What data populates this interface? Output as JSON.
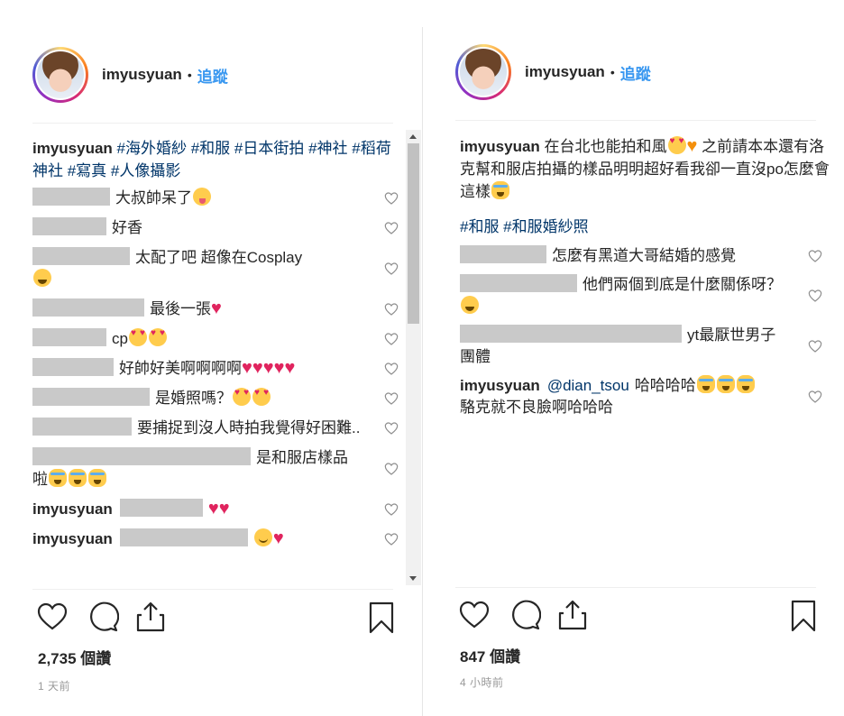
{
  "left": {
    "username": "imyusyuan",
    "dot": "•",
    "follow": "追蹤",
    "caption_user": "imyusyuan",
    "caption_tags": "#海外婚紗 #和服 #日本街拍 #神社 #稻荷神社 #寫真 #人像攝影",
    "comments": [
      {
        "text": "大叔帥呆了",
        "blur": 86,
        "emojis": [
          "tongue"
        ],
        "wrap": false
      },
      {
        "text": "好香",
        "blur": 82,
        "emojis": [],
        "wrap": false
      },
      {
        "text": "太配了吧 超像在Cosplay",
        "blur": 108,
        "emojis": [
          "laugh"
        ],
        "wrap": true
      },
      {
        "text": "最後一張",
        "blur": 124,
        "emojis": [
          "heart"
        ],
        "wrap": false
      },
      {
        "text": "cp",
        "blur": 82,
        "emojis": [
          "love",
          "love"
        ],
        "wrap": false
      },
      {
        "text": "好帥好美啊啊啊啊",
        "blur": 90,
        "emojis": [
          "heart",
          "heart",
          "heart",
          "heart",
          "heart"
        ],
        "wrap": false
      },
      {
        "text": "是婚照嗎？",
        "blur": 130,
        "emojis": [
          "love",
          "love"
        ],
        "wrap": false
      },
      {
        "text": "要捕捉到沒人時拍我覺得好困難..",
        "blur": 110,
        "emojis": [],
        "wrap": false
      },
      {
        "text": "是和服店樣品啦",
        "blur": 242,
        "emojis": [
          "cat",
          "cat",
          "cat"
        ],
        "wrap": false
      },
      {
        "text": "",
        "user": "imyusyuan",
        "blur": 92,
        "emojis": [
          "heart",
          "heart"
        ],
        "wrap": false
      },
      {
        "text": "",
        "user": "imyusyuan",
        "blur": 142,
        "emojis": [
          "smile",
          "heart"
        ],
        "wrap": false
      }
    ],
    "likes": "2,735 個讚",
    "time": "1 天前"
  },
  "right": {
    "username": "imyusyuan",
    "dot": "•",
    "follow": "追蹤",
    "caption_user": "imyusyuan",
    "caption_text_a": "在台北也能拍和風",
    "caption_text_b": "之前請本本還有洛克幫和服店拍攝的樣品明明超好看我卻一直沒po怎麼會這樣",
    "caption_tags": "#和服 #和服婚紗照",
    "comments": [
      {
        "text": "怎麼有黑道大哥結婚的感覺",
        "blur": 96,
        "emojis": []
      },
      {
        "text": "他們兩個到底是什麼關係呀？",
        "blur": 130,
        "emojis": [
          "laugh"
        ]
      },
      {
        "text": "yt最厭世男子團體",
        "blur": 246,
        "emojis": []
      },
      {
        "user": "imyusyuan",
        "mention": "@dian_tsou",
        "text": "哈哈哈哈",
        "text2": "駱克就不良臉啊哈哈哈",
        "emojis": [
          "cat",
          "cat",
          "cat"
        ]
      }
    ],
    "likes": "847 個讚",
    "time": "4 小時前"
  }
}
